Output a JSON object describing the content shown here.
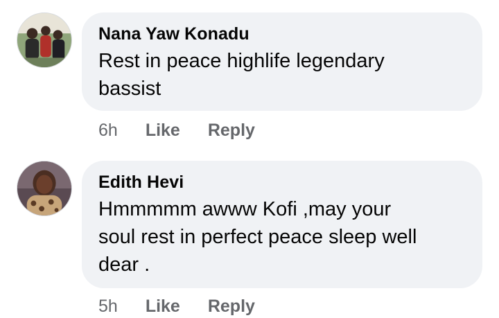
{
  "comments": [
    {
      "author": "Nana Yaw Konadu",
      "text_lines": [
        "Rest in peace highlife legendary",
        "bassist"
      ],
      "time": "6h",
      "like_label": "Like",
      "reply_label": "Reply",
      "avatar_icon": "profile-photo-group-icon"
    },
    {
      "author": "Edith Hevi",
      "text_lines": [
        "Hmmmmm awww Kofi ,may your",
        "soul rest in perfect peace sleep well",
        "dear ."
      ],
      "time": "5h",
      "like_label": "Like",
      "reply_label": "Reply",
      "avatar_icon": "profile-photo-woman-icon"
    }
  ],
  "colors": {
    "bubble_bg": "#f0f2f5",
    "name_text": "#050505",
    "action_text": "#65676b"
  }
}
